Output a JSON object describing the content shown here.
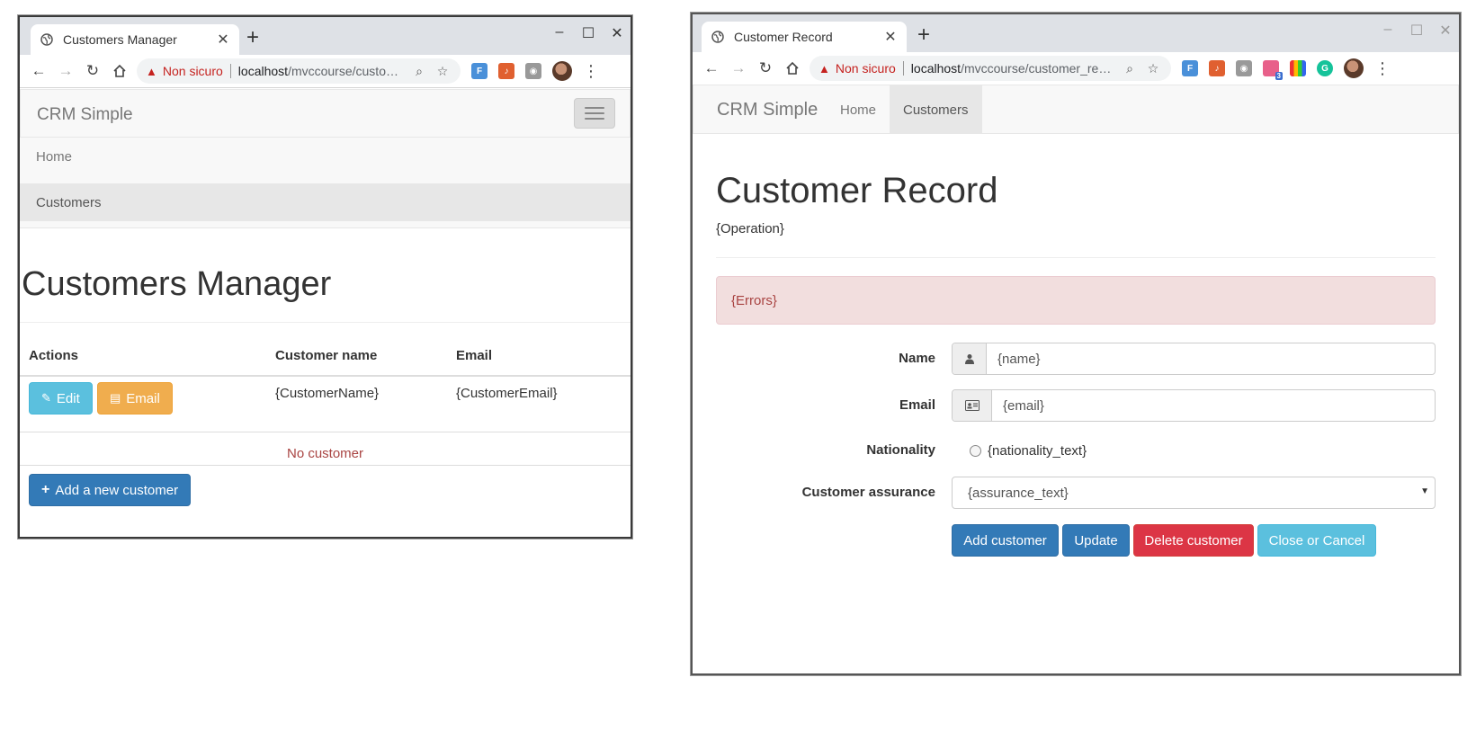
{
  "left_window": {
    "tab_title": "Customers Manager",
    "new_tab": "+",
    "window_controls": [
      "–",
      "☐",
      "✕"
    ],
    "omnibox": {
      "security_label": "Non sicuro",
      "url_host": "localhost",
      "url_path": "/mvccourse/custo…"
    },
    "page": {
      "brand": "CRM Simple",
      "menu": [
        "Home",
        "Customers"
      ],
      "title": "Customers Manager",
      "table": {
        "headers": [
          "Actions",
          "Customer name",
          "Email"
        ],
        "row": {
          "edit_label": "Edit",
          "email_label": "Email",
          "customer_name": "{CustomerName}",
          "customer_email": "{CustomerEmail}"
        },
        "empty_text": "No customer"
      },
      "add_button": "Add a new customer"
    }
  },
  "right_window": {
    "tab_title": "Customer Record",
    "new_tab": "+",
    "window_controls": [
      "–",
      "☐",
      "✕"
    ],
    "omnibox": {
      "security_label": "Non sicuro",
      "url_host": "localhost",
      "url_path": "/mvccourse/customer_re…"
    },
    "page": {
      "brand": "CRM Simple",
      "nav": [
        "Home",
        "Customers"
      ],
      "active_nav": "Customers",
      "title": "Customer Record",
      "operation": "{Operation}",
      "errors": "{Errors}",
      "form": {
        "name_label": "Name",
        "name_value": "{name}",
        "email_label": "Email",
        "email_value": "{email}",
        "nationality_label": "Nationality",
        "nationality_option": "{nationality_text}",
        "assurance_label": "Customer assurance",
        "assurance_value": "{assurance_text}"
      },
      "buttons": {
        "add": "Add customer",
        "update": "Update",
        "delete": "Delete customer",
        "close": "Close or Cancel"
      }
    }
  },
  "extension_badge": "3",
  "colors": {
    "info": "#5bc0de",
    "warning": "#f0ad4e",
    "primary": "#337ab7",
    "danger": "#dc3545",
    "alert_bg": "#f2dede",
    "insecure": "#c5221f"
  }
}
